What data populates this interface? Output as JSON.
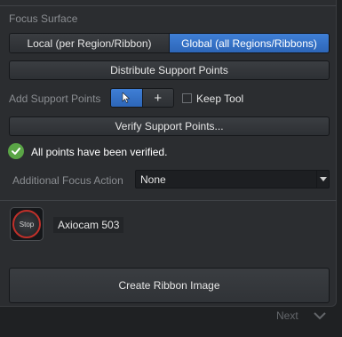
{
  "section": {
    "title": "Focus Surface"
  },
  "focus_mode": {
    "options": [
      {
        "label": "Local (per Region/Ribbon)",
        "selected": false
      },
      {
        "label": "Global (all Regions/Ribbons)",
        "selected": true
      }
    ]
  },
  "buttons": {
    "distribute": "Distribute Support Points",
    "verify": "Verify Support Points...",
    "create": "Create Ribbon Image"
  },
  "add_support": {
    "label": "Add Support Points",
    "pointer_icon": "cursor-arrow-icon",
    "add_icon": "plus-icon",
    "add_glyph": "+",
    "keep_tool_label": "Keep Tool",
    "keep_tool_checked": false
  },
  "status": {
    "icon": "check-circle-icon",
    "text": "All points have been verified.",
    "color": "#5aa546"
  },
  "focus_action": {
    "label": "Additional Focus Action",
    "value": "None"
  },
  "camera": {
    "stop_label": "Stop",
    "name": "Axiocam 503"
  },
  "nav": {
    "next": "Next"
  },
  "colors": {
    "accent": "#3f7fd6",
    "stop_ring": "#c0302a"
  }
}
